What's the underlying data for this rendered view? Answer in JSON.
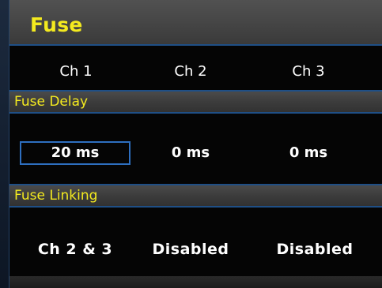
{
  "title": "Fuse",
  "channels": [
    "Ch 1",
    "Ch 2",
    "Ch 3"
  ],
  "fuse_delay": {
    "label": "Fuse Delay",
    "values": [
      "20 ms",
      "0 ms",
      "0 ms"
    ]
  },
  "fuse_linking": {
    "label": "Fuse Linking",
    "values": [
      "Ch 2 & 3",
      "Disabled",
      "Disabled"
    ]
  },
  "colors": {
    "accent": "#f4ea1f",
    "border": "#1f4f86",
    "focus": "#2e6fc0"
  }
}
